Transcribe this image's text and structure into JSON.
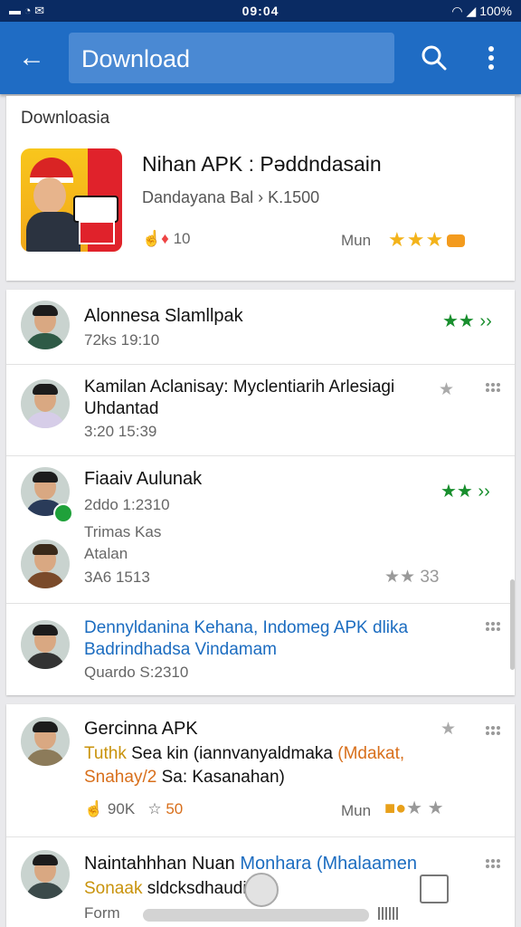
{
  "status_bar": {
    "time": "09:04",
    "battery": "100%"
  },
  "app_bar": {
    "search_query": "Download"
  },
  "featured": {
    "section_label": "Downloasia",
    "title": "Nihan APK : Pəddndasain",
    "subtitle": "Dandayana Bal › K.1500",
    "stats": "10",
    "more_label": "Mun"
  },
  "list": [
    {
      "name": "Alonnesa Slamllpak",
      "stats": "72ks  19:10",
      "rating": "★★ ››"
    },
    {
      "name": "Kamilan Aclanisay: Myclentiarih Arlesiagi",
      "name2": "Uhdantad",
      "stats": "3:20  15:39"
    },
    {
      "name": "Fiaaiv Aulunak",
      "stats": "2ddo  1:2310",
      "rating": "★★ ››",
      "line3": "Trimas Kas"
    },
    {
      "name": "Atalan",
      "stats": "3A6  1513",
      "rating": "33"
    },
    {
      "name": "Dennyldanina Kehana, Indomeg APK dlika",
      "name2": "Badrindhadsa Vindamam",
      "stats": "Quardo  S:2310"
    }
  ],
  "card3": {
    "item1": {
      "name": "Gercinna APK",
      "line2a": "Tuthk",
      "line2b": " Sea kin (iannvanyaldmaka ",
      "line2c": "(Mdakat,",
      "line3a": "Snahay/2",
      "line3b": " Sa: Kasanahan)",
      "stats": "90K",
      "stat2": "50",
      "more_label": "Mun"
    },
    "item2": {
      "name": "Naintahhhan Nuan",
      "name_blue": "Monhara (Mhalaamen",
      "line2a": "Sonaak",
      "line2b": " sldcksdhaudin",
      "line3": "Form"
    }
  }
}
